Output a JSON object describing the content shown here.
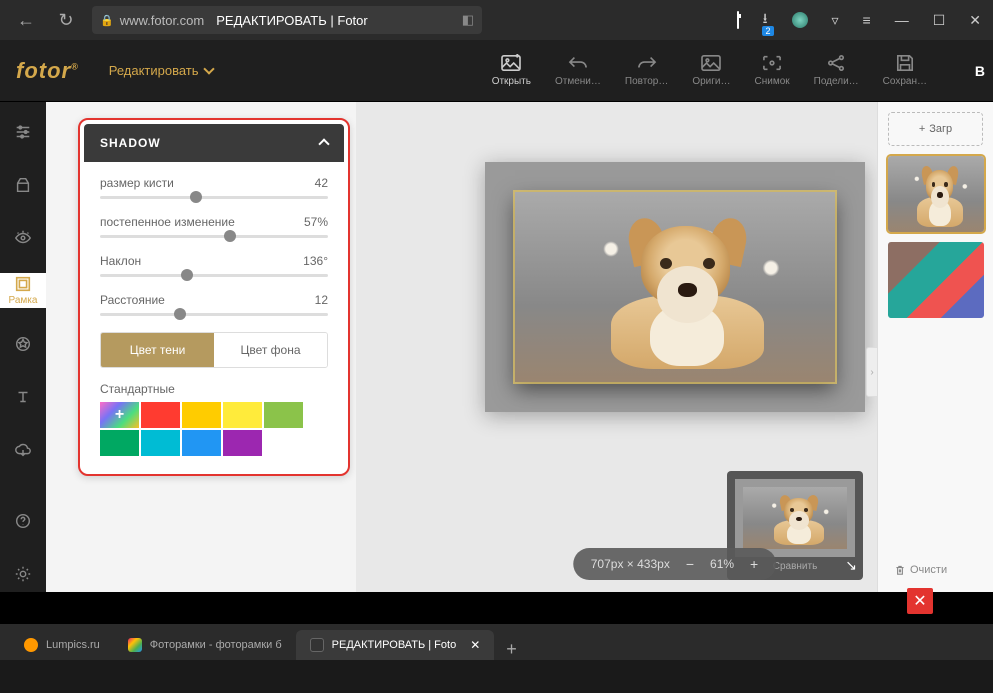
{
  "browser": {
    "domain": "www.fotor.com",
    "page_title": "РЕДАКТИРОВАТЬ | Fotor",
    "download_badge": "2"
  },
  "header": {
    "logo": "fotor",
    "menu_edit": "Редактировать",
    "right_label": "B",
    "tools": {
      "open": "Открыть",
      "undo": "Отмени…",
      "redo": "Повтор…",
      "original": "Ориги…",
      "snapshot": "Снимок",
      "share": "Подели…",
      "save": "Сохран…"
    }
  },
  "sidebar": {
    "frame_label": "Рамка"
  },
  "panel": {
    "title": "SHADOW",
    "sliders": {
      "brush": {
        "label": "размер кисти",
        "value": "42",
        "pct": 42
      },
      "fade": {
        "label": "постепенное изменение",
        "value": "57%",
        "pct": 57
      },
      "angle": {
        "label": "Наклон",
        "value": "136°",
        "pct": 38
      },
      "distance": {
        "label": "Расстояние",
        "value": "12",
        "pct": 35
      }
    },
    "tabs": {
      "shadow_color": "Цвет тени",
      "bg_color": "Цвет фона"
    },
    "colors_label": "Стандартные",
    "swatches": [
      "#ff5c9d",
      "#ff3b30",
      "#ffcc00",
      "#ffeb3b",
      "#8bc34a",
      "#00a862",
      "#00bcd4",
      "#2196f3",
      "#9c27b0"
    ]
  },
  "right_rail": {
    "load": "Загр",
    "clear": "Очисти"
  },
  "zoom": {
    "dims": "707px × 433px",
    "percent": "61%",
    "compare": "Сравнить"
  },
  "tabs": [
    {
      "label": "Lumpics.ru",
      "favicon": "#ff9800"
    },
    {
      "label": "Фоторамки - фоторамки б",
      "favicon": "linear-gradient(135deg,#e91e63,#ffc107,#4caf50,#2196f3)"
    },
    {
      "label": "РЕДАКТИРОВАТЬ | Foto",
      "favicon": "#333",
      "active": true
    }
  ]
}
